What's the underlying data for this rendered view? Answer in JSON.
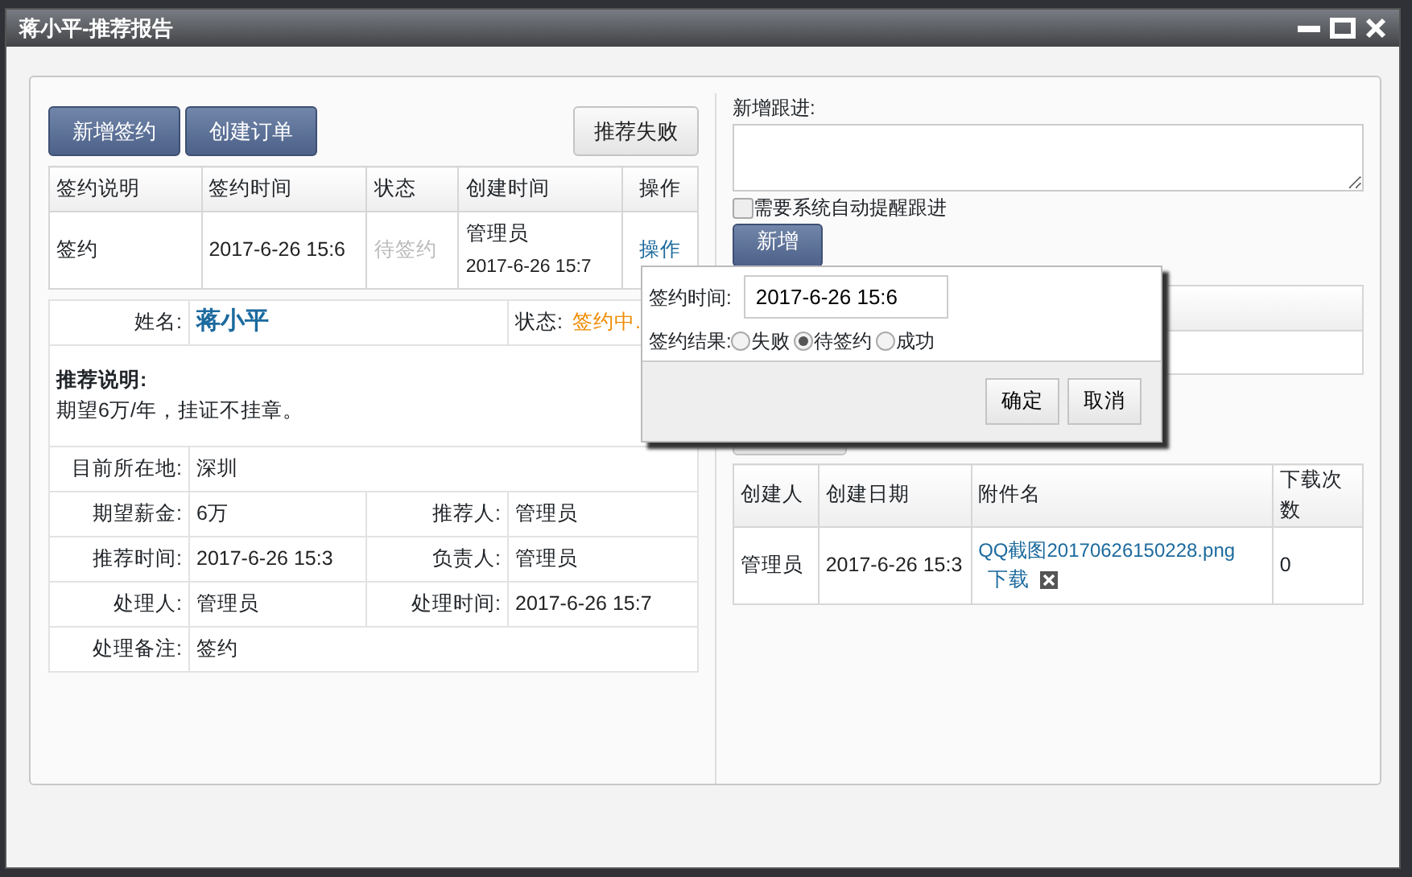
{
  "window": {
    "title": "蒋小平-推荐报告"
  },
  "toolbar": [
    {
      "label": "新增签约",
      "kind": "primary"
    },
    {
      "label": "创建订单",
      "kind": "primary"
    },
    {
      "label": "推荐失败",
      "kind": "default"
    }
  ],
  "sign_table": {
    "columns": [
      "签约说明",
      "签约时间",
      "状态",
      "创建时间",
      "操作"
    ],
    "rows": [
      {
        "description": "签约",
        "time": "2017-6-26 15:6",
        "status": "待签约",
        "creator": "管理员",
        "created_time": "2017-6-26 15:7",
        "action": "操作"
      }
    ]
  },
  "detail": {
    "name_label": "姓名:",
    "name": "蒋小平",
    "status_label": "状态:",
    "status": "签约中.",
    "note_title": "推荐说明:",
    "note_text": "期望6万/年，挂证不挂章。",
    "location_label": "目前所在地:",
    "location": "深圳",
    "pairs": [
      {
        "label": "期望薪金:",
        "value": "6万",
        "label_2": "推荐人:",
        "value_2": "管理员"
      },
      {
        "label": "推荐时间:",
        "value": "2017-6-26 15:3",
        "label_2": "负责人:",
        "value_2": "管理员"
      },
      {
        "label": "处理人:",
        "value": "管理员",
        "label_2": "处理时间:",
        "value_2": "2017-6-26 15:7"
      }
    ],
    "remark_label": "处理备注:",
    "remark": "签约"
  },
  "follow_up": {
    "label": "新增跟进:",
    "reminder": {
      "label": "需要系统自动提醒跟进",
      "checked": false
    },
    "add_button": "新增"
  },
  "attachments": {
    "columns": [
      "创建人",
      "创建日期",
      "附件名",
      "下载次数"
    ],
    "rows": [
      {
        "creator": "管理员",
        "date": "2017-6-26 15:3",
        "file_name": "QQ截图20170626150228.png",
        "download": "下载",
        "count": "0"
      }
    ]
  },
  "popup": {
    "time_label": "签约时间:",
    "time_value": "2017-6-26 15:6",
    "result_label": "签约结果:",
    "options": [
      {
        "label": "失败",
        "selected": false
      },
      {
        "label": "待签约",
        "selected": true
      },
      {
        "label": "成功",
        "selected": false
      }
    ],
    "buttons": [
      "确定",
      "取消"
    ]
  }
}
